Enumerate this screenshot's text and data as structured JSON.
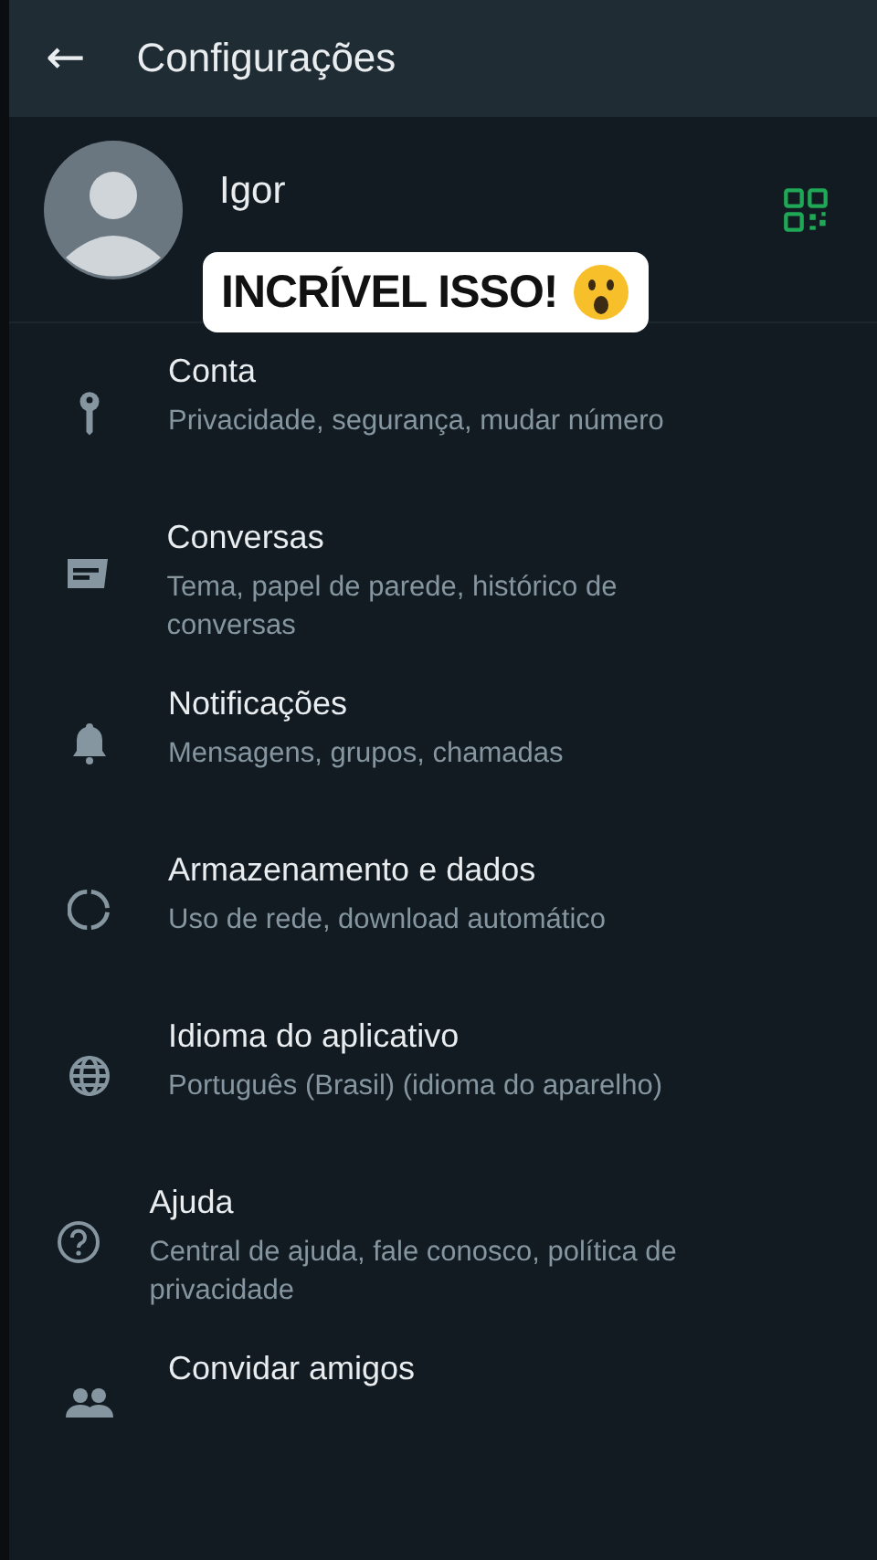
{
  "header": {
    "back": "←",
    "title": "Configurações"
  },
  "profile": {
    "name": "Igor"
  },
  "caption": {
    "text": "INCRÍVEL ISSO!"
  },
  "items": [
    {
      "kind": "key",
      "title": "Conta",
      "subtitle": "Privacidade, segurança, mudar número"
    },
    {
      "kind": "chat",
      "title": "Conversas",
      "subtitle": "Tema, papel de parede, histórico de conversas"
    },
    {
      "kind": "bell",
      "title": "Notificações",
      "subtitle": "Mensagens, grupos, chamadas"
    },
    {
      "kind": "storage",
      "title": "Armazenamento e dados",
      "subtitle": "Uso de rede, download automático"
    },
    {
      "kind": "globe",
      "title": "Idioma do aplicativo",
      "subtitle": "Português (Brasil) (idioma do aparelho)"
    },
    {
      "kind": "help",
      "title": "Ajuda",
      "subtitle": "Central de ajuda, fale conosco, política de privacidade"
    },
    {
      "kind": "people",
      "title": "Convidar amigos"
    }
  ]
}
